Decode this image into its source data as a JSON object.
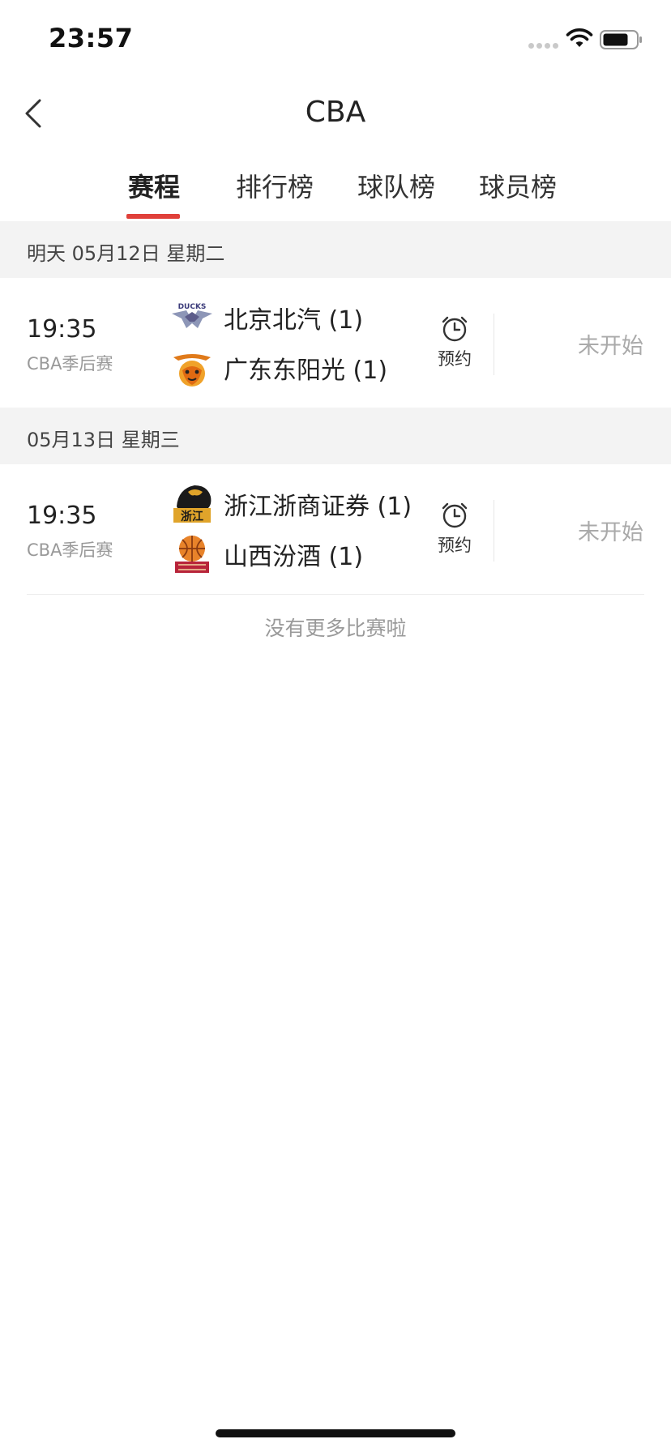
{
  "status_bar": {
    "time": "23:57",
    "icons": [
      "signal-dots-icon",
      "wifi-icon",
      "battery-icon"
    ]
  },
  "nav": {
    "title": "CBA",
    "back_icon": "chevron-left-icon"
  },
  "tabs": [
    {
      "label": "赛程",
      "active": true
    },
    {
      "label": "排行榜",
      "active": false
    },
    {
      "label": "球队榜",
      "active": false
    },
    {
      "label": "球员榜",
      "active": false
    }
  ],
  "days": [
    {
      "date_label": "明天 05月12日 星期二",
      "matches": [
        {
          "time": "19:35",
          "league": "CBA季后赛",
          "home": {
            "name": "北京北汽 (1)",
            "logo": "beijing-ducks-logo",
            "logo_text": "DUCKS"
          },
          "away": {
            "name": "广东东阳光 (1)",
            "logo": "guangdong-tigers-logo"
          },
          "reserve_label": "预约",
          "status": "未开始"
        }
      ]
    },
    {
      "date_label": "05月13日 星期三",
      "matches": [
        {
          "time": "19:35",
          "league": "CBA季后赛",
          "home": {
            "name": "浙江浙商证券 (1)",
            "logo": "zhejiang-lions-logo",
            "logo_text": "浙江"
          },
          "away": {
            "name": "山西汾酒 (1)",
            "logo": "shanxi-dragons-logo"
          },
          "reserve_label": "预约",
          "status": "未开始"
        }
      ]
    }
  ],
  "footer": {
    "no_more_text": "没有更多比赛啦"
  },
  "colors": {
    "accent": "#e0403a",
    "section_bg": "#f3f3f3",
    "muted_text": "#999999"
  }
}
